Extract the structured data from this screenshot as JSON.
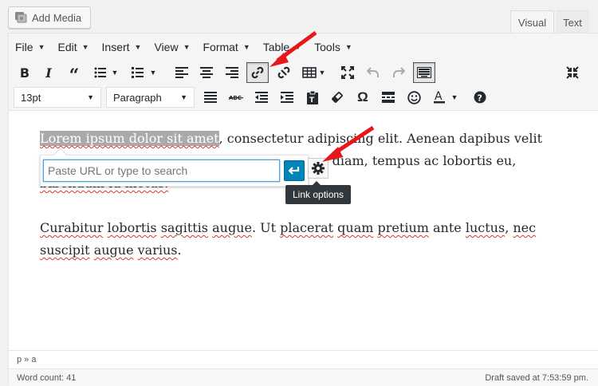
{
  "add_media": {
    "label": "Add Media"
  },
  "tabs": {
    "visual": "Visual",
    "text": "Text"
  },
  "menu": [
    "File",
    "Edit",
    "Insert",
    "View",
    "Format",
    "Table",
    "Tools"
  ],
  "toolbar": {
    "font_size": "13pt",
    "block_format": "Paragraph",
    "special_char": "Ω"
  },
  "content": {
    "p1_selected": "Lorem ipsum dolor sit amet",
    "p1_rest": ", consectetur adipiscing elit. Aenean dapibus velit",
    "p1_line2_end": "us diam, tempus ac lobortis eu,",
    "p1_line3": "bibendum id metus.",
    "p2_w1": "Curabitur",
    "p2_w2": "lobortis",
    "p2_w3": "sagittis",
    "p2_w4": "augue",
    "p2_mid": ". Ut ",
    "p2_w5": "placerat",
    "p2_w6": "quam",
    "p2_w7": "pretium",
    "p2_w8": "ante",
    "p2_w9": "luctus",
    "p2_w10": "nec",
    "p2_w11": "suscipit",
    "p2_w12": "augue",
    "p2_w13": "varius",
    "p2_end": "."
  },
  "link_popup": {
    "placeholder": "Paste URL or type to search",
    "value": ""
  },
  "tooltip": "Link options",
  "path": "p » a",
  "word_count": "Word count: 41",
  "draft_saved": "Draft saved at 7:53:59 pm.",
  "colors": {
    "accent": "#0085ba",
    "arrow": "#e8171a"
  }
}
